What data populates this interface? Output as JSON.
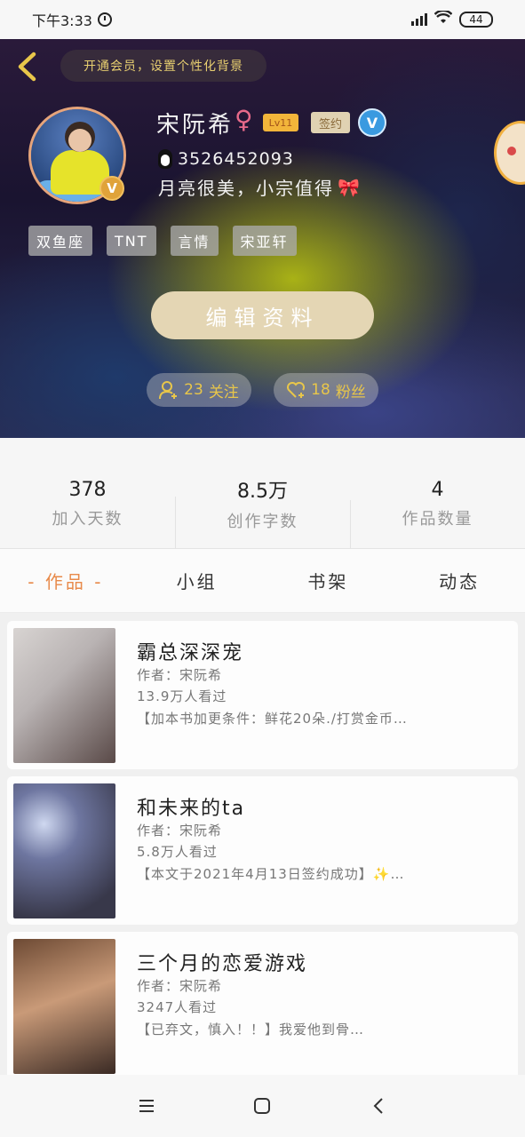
{
  "status_bar": {
    "time": "下午3:33",
    "battery": "44",
    "icons": [
      "alarm-icon",
      "signal-icon",
      "wifi-icon",
      "battery-icon"
    ]
  },
  "header": {
    "vip_banner": "开通会员，设置个性化背景",
    "name": "宋阮希",
    "gender": "♀",
    "level": "Lv11",
    "sign_badge": "签约",
    "verify_badge": "V",
    "qq_number": "3526452093",
    "signature": "月亮很美，小宗值得",
    "signature_emoji": "🎀",
    "tags": [
      "双鱼座",
      "TNT",
      "言情",
      "宋亚轩"
    ],
    "edit_button": "编辑资料",
    "follow_count": "23",
    "follow_label": "关注",
    "fans_count": "18",
    "fans_label": "粉丝"
  },
  "stats": [
    {
      "value": "378",
      "label": "加入天数"
    },
    {
      "value": "8.5万",
      "label": "创作字数"
    },
    {
      "value": "4",
      "label": "作品数量"
    }
  ],
  "tabs": [
    {
      "label": "- 作品 -",
      "active": true
    },
    {
      "label": "小组",
      "active": false
    },
    {
      "label": "书架",
      "active": false
    },
    {
      "label": "动态",
      "active": false
    }
  ],
  "works": [
    {
      "title": "霸总深深宠",
      "author": "作者：宋阮希",
      "views": "13.9万人看过",
      "desc": "【加本书加更条件：鲜花20朵./打赏金币…"
    },
    {
      "title": "和未来的ta",
      "author": "作者：宋阮希",
      "views": "5.8万人看过",
      "desc": "【本文于2021年4月13日签约成功】✨…"
    },
    {
      "title": "三个月的恋爱游戏",
      "author": "作者：宋阮希",
      "views": "3247人看过",
      "desc": "【已弃文，慎入！！】我爱他到骨…"
    }
  ],
  "colors": {
    "accent_orange": "#e88a4a",
    "gold": "#e8c64a",
    "edit_button_bg": "#e4d6b4"
  }
}
